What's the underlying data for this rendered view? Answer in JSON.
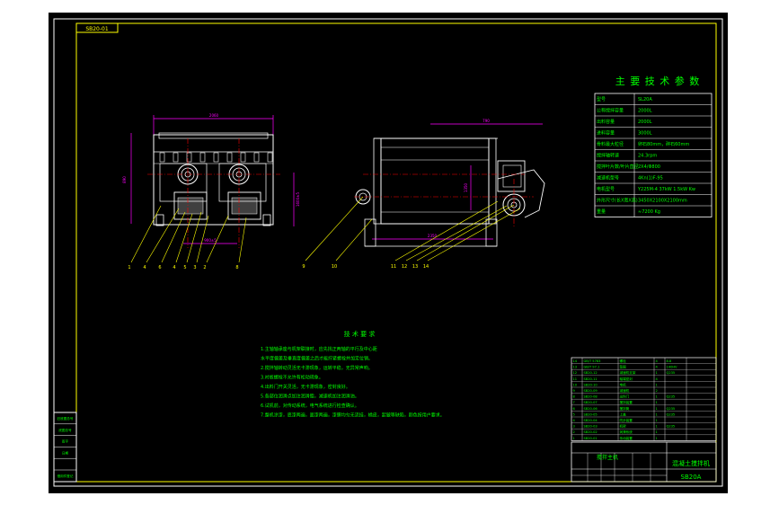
{
  "colors": {
    "frame": "#ffffff",
    "border": "#ffff00",
    "geometry": "#ffffff",
    "dimension": "#ff00ff",
    "center_line": "#ff0000",
    "leader": "#ffff00",
    "text": "#00ff00",
    "title_text": "#ffff00",
    "background": "#000000"
  },
  "drawing": {
    "top_left_tag": "SB20-01",
    "title_params": "主 要 技 术 参 数",
    "notes_title": "技 术 要 求",
    "parts_front": [
      "1",
      "4",
      "6",
      "4",
      "5",
      "3",
      "2",
      "8"
    ],
    "parts_side": [
      "9",
      "10",
      "11",
      "12",
      "13",
      "14"
    ],
    "dims": {
      "front_width": "2060",
      "front_height": "890",
      "front_right": "1600±5",
      "front_bottom": "900±5",
      "side_top": "790",
      "side_bottom": "2350",
      "side_right": "1350"
    }
  },
  "params_table": [
    {
      "label": "型号",
      "value": "SL20A"
    },
    {
      "label": "公称搅拌容量",
      "value": "2000L"
    },
    {
      "label": "出料容量",
      "value": "2000L"
    },
    {
      "label": "进料容量",
      "value": "3000L"
    },
    {
      "label": "骨料最大粒径",
      "value": "卵石80mm，碎石60mm"
    },
    {
      "label": "搅拌轴转速",
      "value": "24.3rpm"
    },
    {
      "label": "搅拌叶片数/叶片直径",
      "value": "2X4/Φ800"
    },
    {
      "label": "减速机型号",
      "value": "4Kn(1)F-95"
    },
    {
      "label": "电机型号",
      "value": "Y225M-4 37kW 1.5kW Kw"
    },
    {
      "label": "外形尺寸(长X宽X高)",
      "value": "3450X2100X2100mm"
    },
    {
      "label": "重量",
      "value": "≈7200 Kg"
    }
  ],
  "notes": [
    "1.主轴轴承座与机架联接时，应先找正两轴的平行及中心距",
    "  水平度偏差及垂直度偏差之后才能拧紧螺栓并加定位销。",
    "2.搅拌轴转动灵活无卡滞现象，运转平稳，无异常声响。",
    "3.衬板螺栓不允许有松动现象。",
    "4.出料门开关灵活，无卡滞现象，密封良好。",
    "5.各部位润滑点加注润滑脂，减速机加注润滑油。",
    "6.试机前，对传动系统，电气系统进行检查确认。",
    "7.整机涂漆，底漆两遍，面漆两遍，漆膜均匀无流挂，橘皮，起皱等缺陷，颜色按用户要求。"
  ],
  "bom_rows": [
    [
      "14",
      "GB/T 5783",
      "螺栓",
      "4",
      "8.8"
    ],
    [
      "13",
      "GB/T 97.1",
      "垫圈",
      "4",
      "140HV"
    ],
    [
      "12",
      "SB20-12",
      "减速机支架",
      "1",
      "Q235"
    ],
    [
      "11",
      "SB20-11",
      "轴端密封",
      "4",
      ""
    ],
    [
      "10",
      "SB20-10",
      "电机",
      "1",
      ""
    ],
    [
      "9",
      "SB20-09",
      "减速机",
      "2",
      ""
    ],
    [
      "8",
      "SB20-08",
      "出料门",
      "1",
      "Q235"
    ],
    [
      "7",
      "SB20-07",
      "搅拌装置",
      "1",
      ""
    ],
    [
      "6",
      "SB20-06",
      "搅拌筒",
      "1",
      "Q235"
    ],
    [
      "5",
      "SB20-05",
      "上盖",
      "1",
      "Q235"
    ],
    [
      "4",
      "SB20-04",
      "同步装置",
      "1",
      ""
    ],
    [
      "3",
      "SB20-03",
      "机架",
      "1",
      "Q235"
    ],
    [
      "2",
      "SB20-02",
      "润滑系统",
      "1",
      ""
    ],
    [
      "1",
      "SB20-01",
      "传动装置",
      "1",
      ""
    ]
  ],
  "title_block": {
    "name": "搅拌主机",
    "project": "混凝土搅拌机",
    "drawing_no": "SB20A"
  },
  "side_block_rows": [
    "旧底图总号",
    "底图总号",
    "签字",
    "日期",
    "",
    "借用件登记"
  ]
}
